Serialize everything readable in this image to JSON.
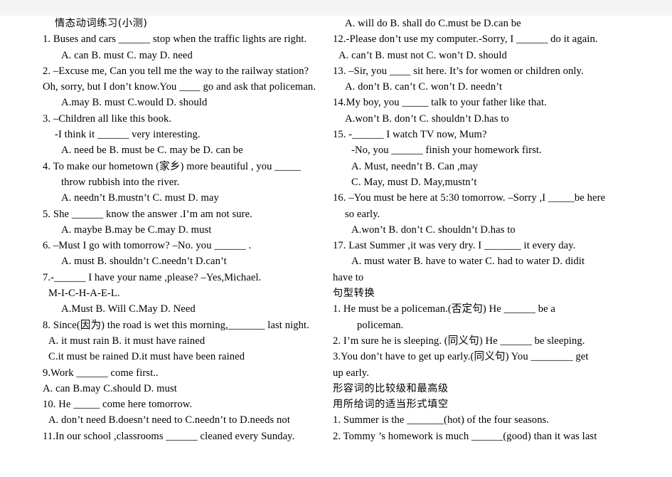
{
  "document": {
    "title_cn": "情态动词练习(小测)",
    "background_band_color": "#f4f4f4",
    "page_color": "#ffffff",
    "text_color": "#000000"
  },
  "left_column": {
    "lines": [
      {
        "id": "title",
        "text": "情态动词练习(小测)",
        "script": "cjk",
        "indent": "i2"
      },
      {
        "id": "q1",
        "text": "1.  Buses  and  cars  ______  stop  when  the  traffic  lights  are  right.",
        "indent": "i0"
      },
      {
        "id": "q1opt",
        "text": "A. can      B. must      C.  may      D.  need",
        "indent": "i3"
      },
      {
        "id": "q2a",
        "text": "2. –Excuse me, Can you tell me the way to the railway station?",
        "indent": "i0"
      },
      {
        "id": "q2b",
        "text": "Oh, sorry, but I don’t know.You ____ go and ask that policeman.",
        "indent": "i0"
      },
      {
        "id": "q2opt",
        "text": "A.may      B. must      C.would      D.  should",
        "indent": "i3"
      },
      {
        "id": "q3a",
        "text": "3. –Children  all  like  this  book.",
        "indent": "i0"
      },
      {
        "id": "q3b",
        "text": "-I  think  it  ______  very  interesting.",
        "indent": "i2"
      },
      {
        "id": "q3opt",
        "text": "A.  need  be      B.  must  be    C.  may  be    D.  can  be",
        "indent": "i3"
      },
      {
        "id": "q4a",
        "text": "4.  To  make  our  hometown  (家乡)  more  beautiful  ,  you  _____",
        "indent": "i0"
      },
      {
        "id": "q4b",
        "text": "throw  rubbish  into  the  river.",
        "indent": "i3"
      },
      {
        "id": "q4opt",
        "text": "A.  needn’t    B.mustn’t    C.  must    D.  may",
        "indent": "i3"
      },
      {
        "id": "q5",
        "text": "5.  She  ______  know  the  answer  .I’m  am  not  sure.",
        "indent": "i0"
      },
      {
        "id": "q5opt",
        "text": "A.  maybe      B.may  be    C.may    D.  must",
        "indent": "i3"
      },
      {
        "id": "q6",
        "text": "6.  –Must  I  go  with  tomorrow?  –No.  you  ______  .",
        "indent": "i0"
      },
      {
        "id": "q6opt",
        "text": "A.  must      B.  shouldn’t      C.needn’t    D.can’t",
        "indent": "i3"
      },
      {
        "id": "q7a",
        "text": "7.-______      I      have      your      name      ,please?    –Yes,Michael.",
        "indent": "i0"
      },
      {
        "id": "q7b",
        "text": "M-I-C-H-A-E-L.",
        "indent": "i1"
      },
      {
        "id": "q7opt",
        "text": "A.Must      B.  Will    C.May    D.  Need",
        "indent": "i3"
      },
      {
        "id": "q8",
        "text": "8. Since(因为)  the  road  is  wet  this  morning,_______  last  night.",
        "indent": "i0"
      },
      {
        "id": "q8opt1",
        "text": "A.  it  must  rain              B.  it  must  have  rained",
        "indent": "i1"
      },
      {
        "id": "q8opt2",
        "text": "C.it  must  be  rained        D.it  must  have  been  rained",
        "indent": "i1"
      },
      {
        "id": "q9",
        "text": "9.Work  ______  come  first..",
        "indent": "i0"
      },
      {
        "id": "q9opt",
        "text": "A.  can      B.may    C.should    D.  must",
        "indent": "i0"
      },
      {
        "id": "q10",
        "text": "10.  He  _____  come  here  tomorrow.",
        "indent": "i0"
      },
      {
        "id": "q10opt",
        "text": "A.  don’t  need    B.doesn’t  need  to    C.needn’t  to    D.needs  not",
        "indent": "i1"
      },
      {
        "id": "q11",
        "text": "11.In  our  school  ,classrooms  ______  cleaned  every  Sunday.",
        "indent": "i0"
      }
    ]
  },
  "right_column": {
    "lines": [
      {
        "id": "q11opt",
        "text": "A.  will  do      B.  shall  do      C.must  be          D.can  be",
        "indent": "i2"
      },
      {
        "id": "q12",
        "text": "12.-Please  don’t  use  my  computer.-Sorry,  I  ______  do  it  again.",
        "indent": "i0"
      },
      {
        "id": "q12opt",
        "text": "A.  can’t      B.  must  not      C.  won’t      D.  should",
        "indent": "i1"
      },
      {
        "id": "q13",
        "text": "13.  –Sir,  you  ____  sit  here.  It’s  for  women  or  children  only.",
        "indent": "i0"
      },
      {
        "id": "q13opt",
        "text": "A.  don’t    B.  can’t  C.  won’t    D.  needn’t",
        "indent": "i2"
      },
      {
        "id": "q14",
        "text": "14.My  boy,  you  _____  talk  to  your  father  like  that.",
        "indent": "i0"
      },
      {
        "id": "q14opt",
        "text": "A.won’t  B.  don’t    C.  shouldn’t      D.has  to",
        "indent": "i2"
      },
      {
        "id": "q15a",
        "text": "15.  -______ I  watch  TV  now,  Mum?",
        "indent": "i0"
      },
      {
        "id": "q15b",
        "text": "-No,  you  ______  finish  your  homework  first.",
        "indent": "i3"
      },
      {
        "id": "q15opt1",
        "text": "A.  Must,  needn’t            B.  Can  ,may",
        "indent": "i3"
      },
      {
        "id": "q15opt2",
        "text": "C.  May,  must                  D.  May,mustn’t",
        "indent": "i3"
      },
      {
        "id": "q16a",
        "text": "16.  –You  must  be  here  at  5:30  tomorrow.  –Sorry  ,I  _____be  here",
        "indent": "i0"
      },
      {
        "id": "q16b",
        "text": "so  early.",
        "indent": "i2"
      },
      {
        "id": "q16opt",
        "text": "A.won’t      B.  don’t    C.  shouldn’t      D.has  to",
        "indent": "i3"
      },
      {
        "id": "q17",
        "text": "17.  Last  Summer  ,it  was  very  dry.  I  _______  it  every  day.",
        "indent": "i0"
      },
      {
        "id": "q17opt",
        "text": "A.  must  water  B.  have  to  water  C.  had  to  water  D.  didit",
        "indent": "i3"
      },
      {
        "id": "q17cont",
        "text": "have  to",
        "indent": "i0"
      },
      {
        "id": "head2",
        "text": "句型转换",
        "script": "cjk",
        "indent": "i0"
      },
      {
        "id": "t1a",
        "text": "1.  He  must  be  a  policeman.(否定句)  He  ______  be  a",
        "indent": "i0"
      },
      {
        "id": "t1b",
        "text": "policeman.",
        "indent": "i4"
      },
      {
        "id": "t2",
        "text": "2. I’m  sure  he  is  sleeping.  (同义句)  He  ______  be  sleeping.",
        "indent": "i0"
      },
      {
        "id": "t3a",
        "text": "3.You  don’t  have  to  get  up  early.(同义句)  You  ________  get",
        "indent": "i0"
      },
      {
        "id": "t3b",
        "text": "up  early.",
        "indent": "i0"
      },
      {
        "id": "head3",
        "text": "形容词的比较级和最高级",
        "script": "cjk",
        "indent": "i0"
      },
      {
        "id": "head4",
        "text": "用所给词的适当形式填空",
        "script": "cjk",
        "indent": "i0"
      },
      {
        "id": "f1",
        "text": "1.   Summer  is  the  _______(hot)  of  the  four  seasons.",
        "indent": "i0"
      },
      {
        "id": "f2",
        "text": "2.   Tommy ’s  homework  is  much  ______(good)  than  it  was  last",
        "indent": "i0"
      }
    ]
  }
}
